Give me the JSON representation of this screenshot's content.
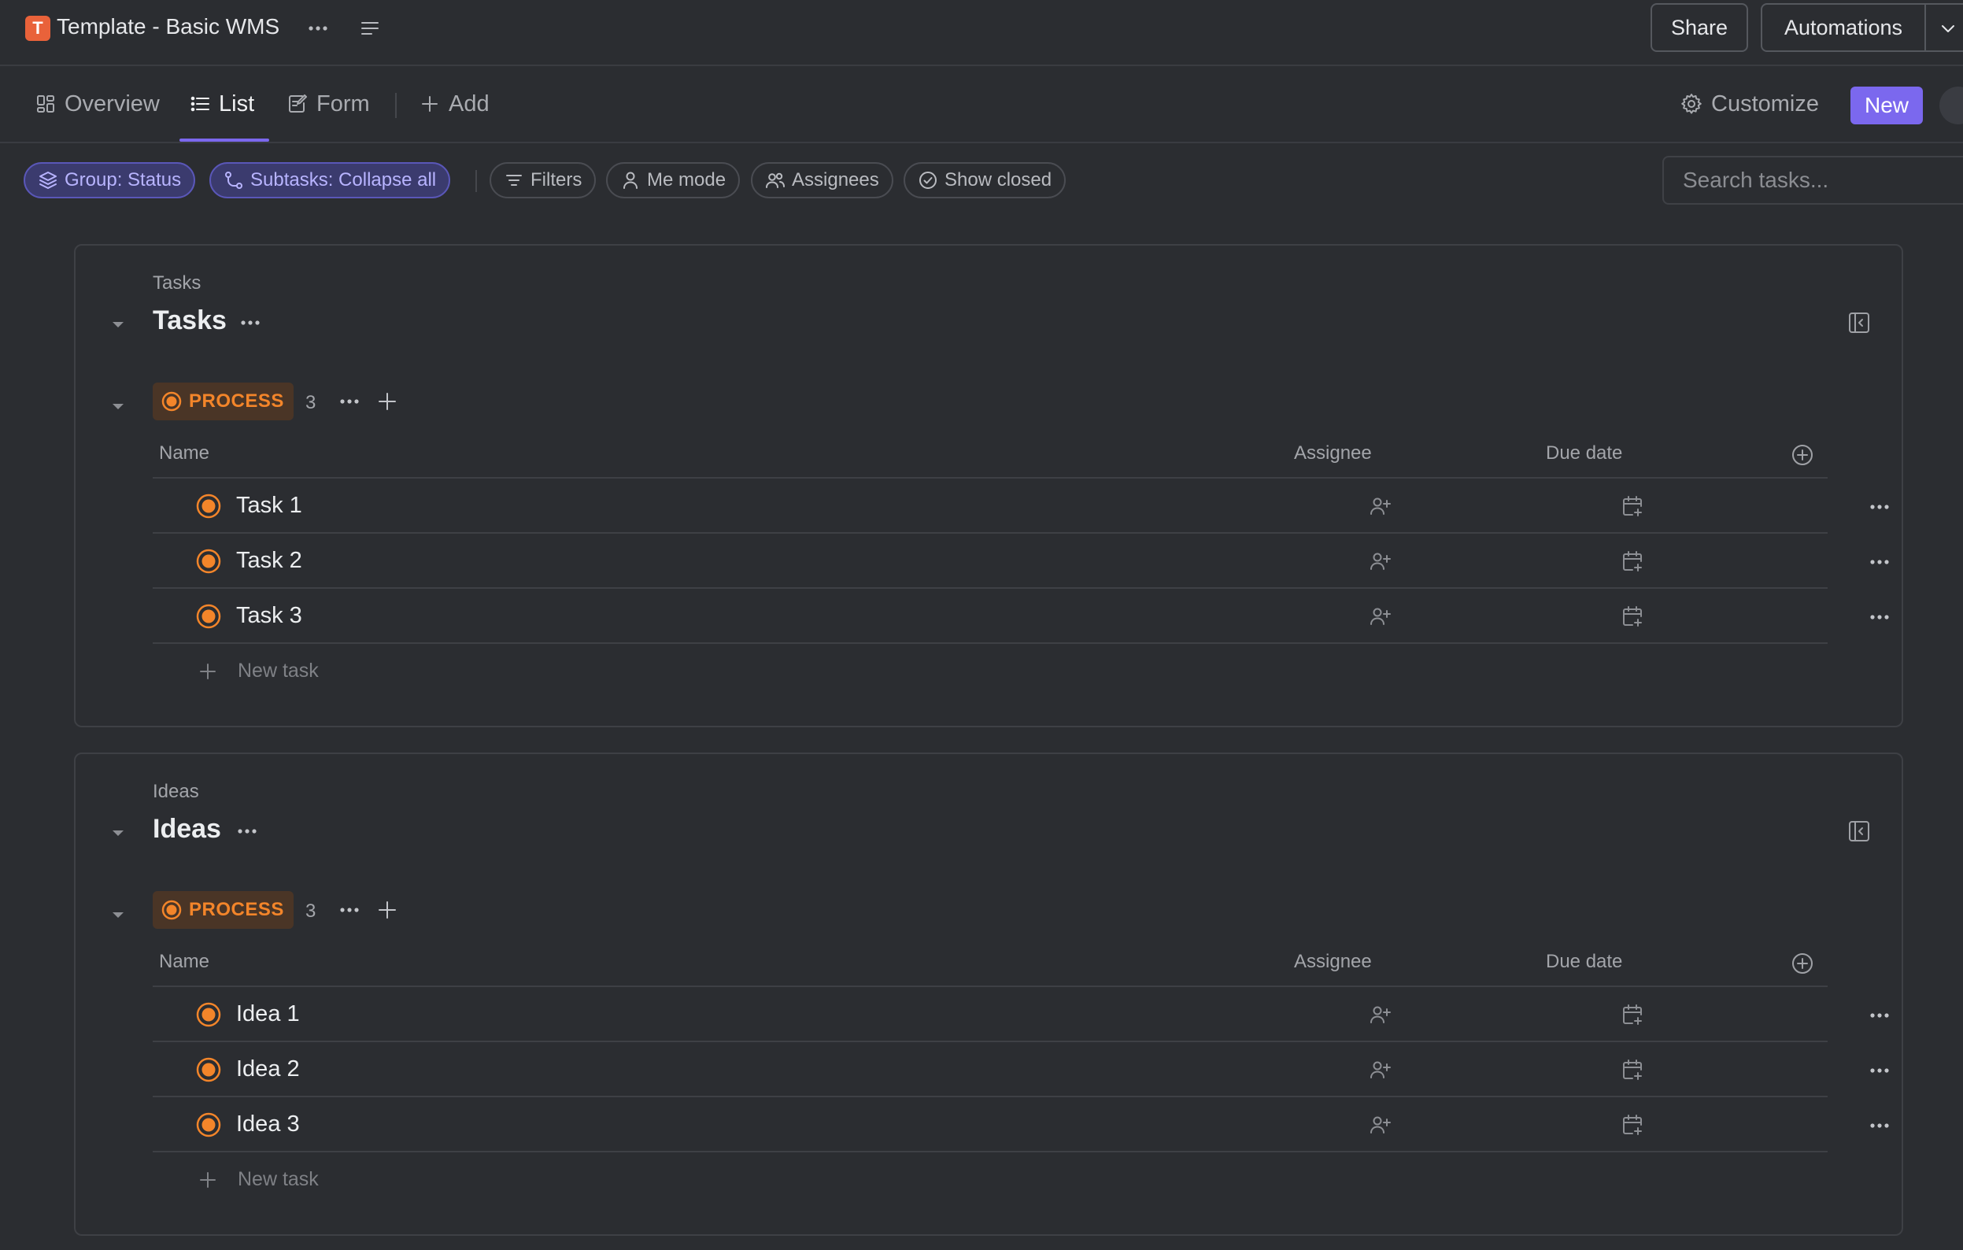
{
  "app": {
    "badge": "T",
    "title": "Template - Basic WMS"
  },
  "header": {
    "share_label": "Share",
    "automations_label": "Automations"
  },
  "views": {
    "tabs": [
      {
        "label": "Overview"
      },
      {
        "label": "List"
      },
      {
        "label": "Form"
      }
    ],
    "add_label": "Add",
    "customize_label": "Customize",
    "new_label": "New",
    "active_tab": "List"
  },
  "filters": {
    "group": "Group: Status",
    "subtasks": "Subtasks: Collapse all",
    "filters": "Filters",
    "me_mode": "Me mode",
    "assignees": "Assignees",
    "show_closed": "Show closed",
    "search_placeholder": "Search tasks..."
  },
  "columns": {
    "name": "Name",
    "assignee": "Assignee",
    "due_date": "Due date"
  },
  "sections": [
    {
      "crumb": "Tasks",
      "title": "Tasks",
      "status": "PROCESS",
      "count": "3",
      "rows": [
        {
          "name": "Task 1"
        },
        {
          "name": "Task 2"
        },
        {
          "name": "Task 3"
        }
      ],
      "new_task_label": "New task"
    },
    {
      "crumb": "Ideas",
      "title": "Ideas",
      "status": "PROCESS",
      "count": "3",
      "rows": [
        {
          "name": "Idea 1"
        },
        {
          "name": "Idea 2"
        },
        {
          "name": "Idea 3"
        }
      ],
      "new_task_label": "New task"
    }
  ],
  "colors": {
    "accent": "#7b68ee",
    "status_process": "#f3852a",
    "app_badge": "#e9623a",
    "background": "#2b2d31"
  },
  "icons": {
    "overview": "grid-icon",
    "list": "list-icon",
    "form": "form-icon",
    "add": "plus-icon",
    "customize": "gear-icon",
    "group": "layers-icon",
    "subtasks": "subtask-icon",
    "filters": "filter-icon",
    "me_mode": "person-icon",
    "assignees": "people-icon",
    "show_closed": "check-circle-icon",
    "collapse": "sidebar-collapse-icon",
    "assignee_cell": "add-person-icon",
    "due_cell": "calendar-plus-icon"
  }
}
